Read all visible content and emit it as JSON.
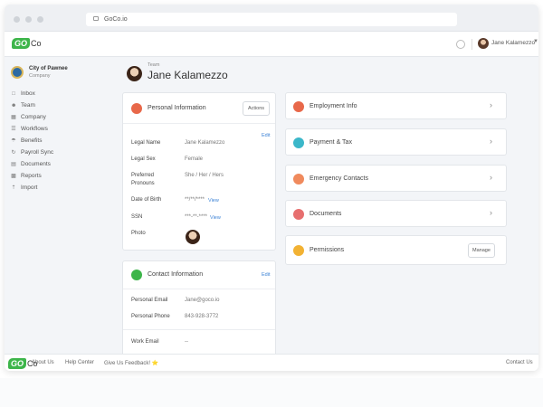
{
  "browser": {
    "url": "GoCo.io"
  },
  "appbar": {
    "logo_go": "GO",
    "logo_co": "Co",
    "user_name": "Jane Kalamezzo"
  },
  "sidebar": {
    "org_name": "City of Pawnee",
    "org_sub": "Company",
    "items": [
      {
        "label": "Inbox",
        "icon": "inbox-icon"
      },
      {
        "label": "Team",
        "icon": "team-icon"
      },
      {
        "label": "Company",
        "icon": "company-icon"
      },
      {
        "label": "Workflows",
        "icon": "workflows-icon"
      },
      {
        "label": "Benefits",
        "icon": "benefits-icon"
      },
      {
        "label": "Payroll Sync",
        "icon": "sync-icon"
      },
      {
        "label": "Documents",
        "icon": "documents-icon"
      },
      {
        "label": "Reports",
        "icon": "reports-icon"
      },
      {
        "label": "Import",
        "icon": "import-icon"
      }
    ]
  },
  "header": {
    "team_label": "Team",
    "title": "Jane Kalamezzo"
  },
  "personal": {
    "title": "Personal Information",
    "actions_label": "Actions",
    "edit_label": "Edit",
    "rows": [
      {
        "label": "Legal Name",
        "value": "Jane Kalamezzo"
      },
      {
        "label": "Legal Sex",
        "value": "Female"
      },
      {
        "label": "Preferred Pronouns",
        "value": "She / Her / Hers"
      },
      {
        "label": "Date of Birth",
        "value": "**/**/****",
        "link": "View"
      },
      {
        "label": "SSN",
        "value": "***-**-****",
        "link": "View"
      },
      {
        "label": "Photo",
        "value": ""
      }
    ]
  },
  "contact": {
    "title": "Contact Information",
    "edit_label": "Edit",
    "rows": [
      {
        "label": "Personal Email",
        "value": "Jane@goco.io"
      },
      {
        "label": "Personal Phone",
        "value": "843-928-3772"
      },
      {
        "label": "Work Email",
        "value": "--"
      }
    ]
  },
  "right_cards": [
    {
      "title": "Employment Info",
      "icon": "employment-icon",
      "color": "#e8684a"
    },
    {
      "title": "Payment & Tax",
      "icon": "payment-icon",
      "color": "#3bb7c9"
    },
    {
      "title": "Emergency Contacts",
      "icon": "emergency-icon",
      "color": "#f08a5d"
    },
    {
      "title": "Documents",
      "icon": "documents-icon",
      "color": "#e76f6f"
    },
    {
      "title": "Permissions",
      "icon": "permissions-icon",
      "color": "#f2b233",
      "button": "Manage"
    }
  ],
  "footer": {
    "links": [
      "About Us",
      "Help Center",
      "Give Us Feedback! ⭐"
    ],
    "contact": "Contact Us"
  }
}
